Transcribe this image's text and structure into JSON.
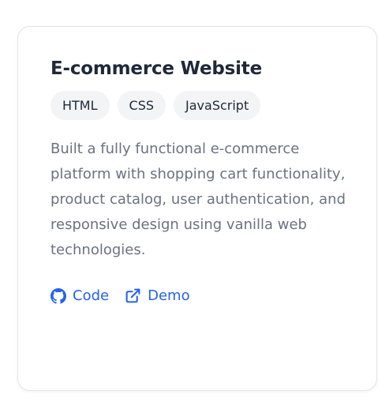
{
  "project": {
    "title": "E-commerce Website",
    "tags": [
      "HTML",
      "CSS",
      "JavaScript"
    ],
    "description": "Built a fully functional e-commerce platform with shopping cart functionality, product catalog, user authentication, and responsive design using vanilla web technologies.",
    "links": {
      "code": {
        "label": "Code",
        "icon": "github-icon"
      },
      "demo": {
        "label": "Demo",
        "icon": "external-link-icon"
      }
    }
  },
  "colors": {
    "title": "#1f2937",
    "text": "#6b7280",
    "link": "#2563eb",
    "tag_bg": "#f3f4f6",
    "border": "#e3e5e8"
  }
}
